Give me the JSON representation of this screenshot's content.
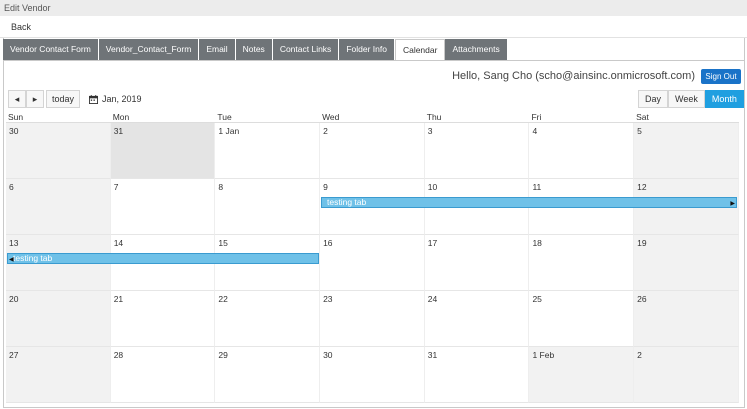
{
  "window": {
    "title": "Edit Vendor"
  },
  "nav": {
    "back_label": "Back"
  },
  "tabs": [
    {
      "label": "Vendor Contact Form"
    },
    {
      "label": "Vendor_Contact_Form"
    },
    {
      "label": "Email"
    },
    {
      "label": "Notes"
    },
    {
      "label": "Contact Links"
    },
    {
      "label": "Folder Info"
    },
    {
      "label": "Calendar"
    },
    {
      "label": "Attachments"
    }
  ],
  "active_tab": "Calendar",
  "user": {
    "greeting": "Hello, Sang Cho (scho@ainsinc.onmicrosoft.com)",
    "sign_out_label": "Sign Out"
  },
  "toolbar": {
    "prev_icon": "◂",
    "next_icon": "▸",
    "today_label": "today",
    "date_label": "Jan, 2019"
  },
  "views": [
    {
      "label": "Day"
    },
    {
      "label": "Week"
    },
    {
      "label": "Month"
    }
  ],
  "active_view": "Month",
  "calendar": {
    "weekdays": [
      "Sun",
      "Mon",
      "Tue",
      "Wed",
      "Thu",
      "Fri",
      "Sat"
    ],
    "weeks": [
      [
        "30",
        "31",
        "1 Jan",
        "2",
        "3",
        "4",
        "5"
      ],
      [
        "6",
        "7",
        "8",
        "9",
        "10",
        "11",
        "12"
      ],
      [
        "13",
        "14",
        "15",
        "16",
        "17",
        "18",
        "19"
      ],
      [
        "20",
        "21",
        "22",
        "23",
        "24",
        "25",
        "26"
      ],
      [
        "27",
        "28",
        "29",
        "30",
        "31",
        "1 Feb",
        "2"
      ]
    ],
    "events": [
      {
        "title": "testing tab",
        "continues": "right"
      },
      {
        "title": "testing tab",
        "continues": "left"
      }
    ]
  },
  "colors": {
    "tab_bg": "#6f7478",
    "accent": "#1f9fe0",
    "sign_out": "#1a73c8",
    "event": "#6fc1e8"
  }
}
